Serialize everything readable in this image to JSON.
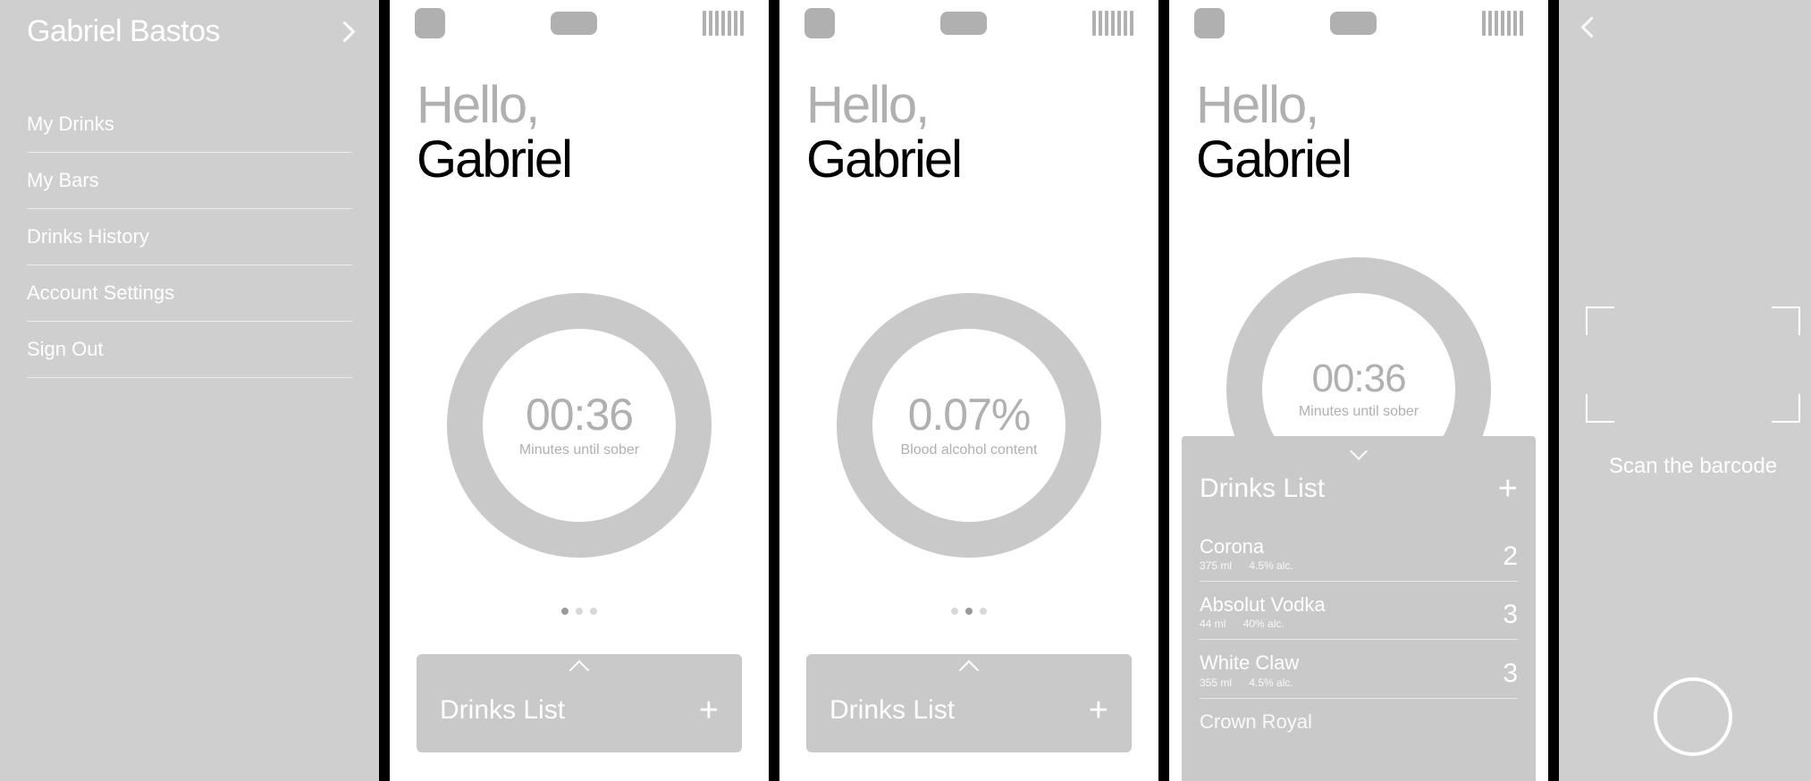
{
  "menu": {
    "user_name": "Gabriel Bastos",
    "items": [
      "My Drinks",
      "My Bars",
      "Drinks History",
      "Account Settings",
      "Sign Out"
    ]
  },
  "home": {
    "greeting": "Hello,",
    "first_name": "Gabriel",
    "metric_time": {
      "value": "00:36",
      "label": "Minutes until sober"
    },
    "metric_bac": {
      "value": "0.07%",
      "label": "Blood alcohol content"
    },
    "drinks_bar_title": "Drinks List"
  },
  "drinks": {
    "title": "Drinks List",
    "items": [
      {
        "name": "Corona",
        "vol": "375 ml",
        "alc": "4.5% alc.",
        "count": "2"
      },
      {
        "name": "Absolut Vodka",
        "vol": "44 ml",
        "alc": "40% alc.",
        "count": "3"
      },
      {
        "name": "White Claw",
        "vol": "355 ml",
        "alc": "4.5% alc.",
        "count": "3"
      }
    ],
    "peek_name": "Crown Royal"
  },
  "scanner": {
    "prompt": "Scan the barcode"
  }
}
